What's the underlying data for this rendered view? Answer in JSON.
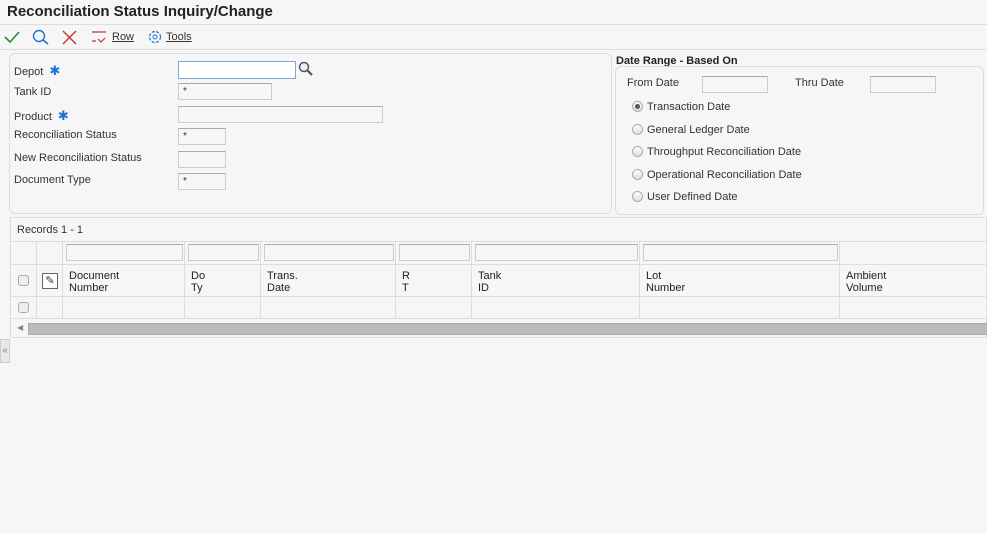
{
  "title": "Reconciliation Status Inquiry/Change",
  "toolbar": {
    "row_label": "Row",
    "tools_label": "Tools"
  },
  "form": {
    "depot": {
      "label": "Depot",
      "value": ""
    },
    "tank_id": {
      "label": "Tank ID",
      "value": "*"
    },
    "product": {
      "label": "Product",
      "value": ""
    },
    "recon_status": {
      "label": "Reconciliation Status",
      "value": "*"
    },
    "new_recon_status": {
      "label": "New Reconciliation Status",
      "value": ""
    },
    "doc_type": {
      "label": "Document Type",
      "value": "*"
    }
  },
  "date_range": {
    "title": "Date Range - Based On",
    "from_label": "From Date",
    "from_value": "",
    "thru_label": "Thru Date",
    "thru_value": "",
    "options": [
      "Transaction Date",
      "General Ledger Date",
      "Throughput Reconciliation Date",
      "Operational Reconciliation Date",
      "User Defined Date"
    ],
    "selected": 0
  },
  "grid": {
    "records": "Records 1 - 1",
    "columns": [
      [
        "Document",
        "Number"
      ],
      [
        "Do",
        "Ty"
      ],
      [
        "Trans.",
        "Date"
      ],
      [
        "R",
        "T"
      ],
      [
        "Tank",
        "ID"
      ],
      [
        "Lot",
        "Number"
      ],
      [
        "Ambient",
        "Volume"
      ]
    ]
  },
  "colors": {
    "accent": "#1a74d0",
    "check": "#2e8b2e",
    "cancel": "#d03030"
  }
}
